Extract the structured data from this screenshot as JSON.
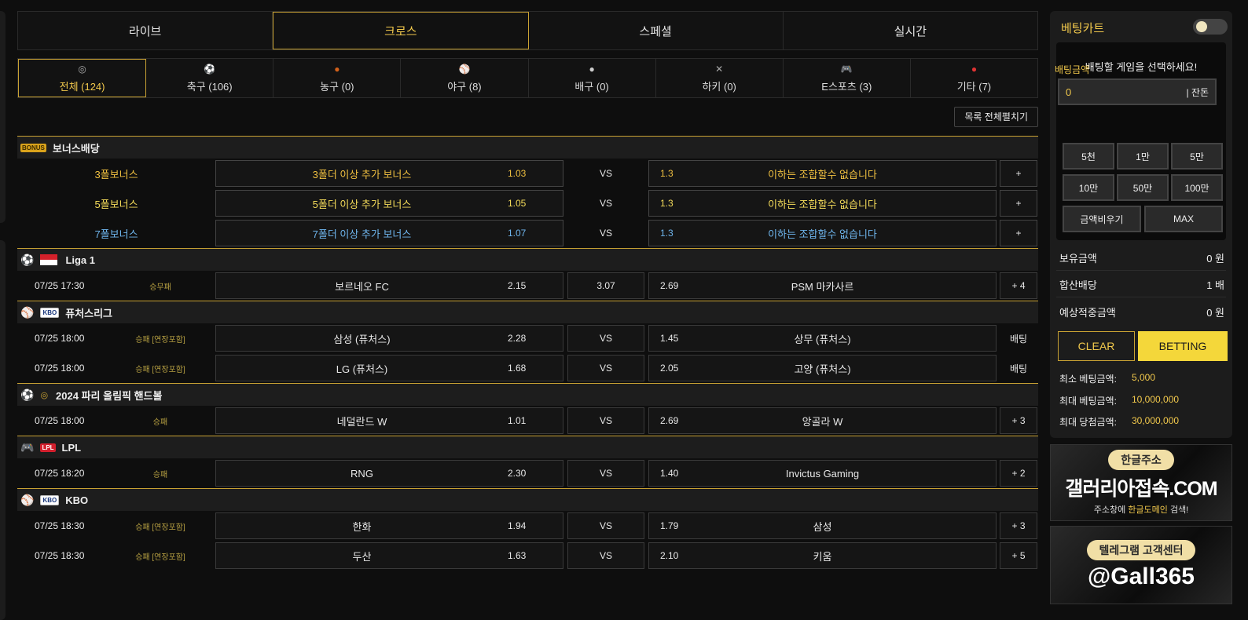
{
  "top_tabs": [
    {
      "label": "라이브"
    },
    {
      "label": "크로스"
    },
    {
      "label": "스페셜"
    },
    {
      "label": "실시간"
    }
  ],
  "sport_tabs": [
    {
      "label": "전체 (124)",
      "icon": "olympic-rings-icon"
    },
    {
      "label": "축구 (106)",
      "icon": "soccer-ball-icon"
    },
    {
      "label": "농구 (0)",
      "icon": "basketball-icon"
    },
    {
      "label": "야구 (8)",
      "icon": "baseball-icon"
    },
    {
      "label": "배구 (0)",
      "icon": "volleyball-icon"
    },
    {
      "label": "하키 (0)",
      "icon": "hockey-sticks-icon"
    },
    {
      "label": "E스포츠 (3)",
      "icon": "gamepad-icon"
    },
    {
      "label": "기타 (7)",
      "icon": "more-dots-icon"
    }
  ],
  "expand_all_label": "목록 전체펼치기",
  "bonus": {
    "title": "보너스배당",
    "logo_text": "BONUS",
    "rows": [
      {
        "name": "3폴보너스",
        "home": "3폴더 이상 추가 보너스",
        "home_odds": "1.03",
        "mid": "VS",
        "away_odds": "1.3",
        "away": "이하는 조합할수 없습니다",
        "more": "+"
      },
      {
        "name": "5폴보너스",
        "home": "5폴더 이상 추가 보너스",
        "home_odds": "1.05",
        "mid": "VS",
        "away_odds": "1.3",
        "away": "이하는 조합할수 없습니다",
        "more": "+"
      },
      {
        "name": "7폴보너스",
        "home": "7폴더 이상 추가 보너스",
        "home_odds": "1.07",
        "mid": "VS",
        "away_odds": "1.3",
        "away": "이하는 조합할수 없습니다",
        "more": "+"
      }
    ]
  },
  "leagues": [
    {
      "name": "Liga 1",
      "sport_icon": "soccer-ball-icon",
      "rows": [
        {
          "time": "07/25 17:30",
          "type": "승무패",
          "home": "보르네오 FC",
          "home_odds": "2.15",
          "mid": "3.07",
          "away_odds": "2.69",
          "away": "PSM 마카사르",
          "more": "+ 4"
        }
      ]
    },
    {
      "name": "퓨처스리그",
      "sport_icon": "baseball-icon",
      "logo_text": "KBO",
      "rows": [
        {
          "time": "07/25 18:00",
          "type": "승패 [연장포함]",
          "home": "삼성 (퓨처스)",
          "home_odds": "2.28",
          "mid": "VS",
          "away_odds": "1.45",
          "away": "상무 (퓨처스)",
          "more": "배팅"
        },
        {
          "time": "07/25 18:00",
          "type": "승패 [연장포함]",
          "home": "LG (퓨처스)",
          "home_odds": "1.68",
          "mid": "VS",
          "away_odds": "2.05",
          "away": "고양 (퓨처스)",
          "more": "배팅"
        }
      ]
    },
    {
      "name": "2024 파리 올림픽 핸드볼",
      "sport_icon": "handball-icon",
      "rows": [
        {
          "time": "07/25 18:00",
          "type": "승패",
          "home": "네덜란드 W",
          "home_odds": "1.01",
          "mid": "VS",
          "away_odds": "2.69",
          "away": "앙골라 W",
          "more": "+ 3"
        }
      ]
    },
    {
      "name": "LPL",
      "sport_icon": "gamepad-icon",
      "logo_text": "LPL",
      "rows": [
        {
          "time": "07/25 18:20",
          "type": "승패",
          "home": "RNG",
          "home_odds": "2.30",
          "mid": "VS",
          "away_odds": "1.40",
          "away": "Invictus Gaming",
          "more": "+ 2"
        }
      ]
    },
    {
      "name": "KBO",
      "sport_icon": "baseball-icon",
      "logo_text": "KBO",
      "rows": [
        {
          "time": "07/25 18:30",
          "type": "승패 [연장포함]",
          "home": "한화",
          "home_odds": "1.94",
          "mid": "VS",
          "away_odds": "1.79",
          "away": "삼성",
          "more": "+ 3"
        },
        {
          "time": "07/25 18:30",
          "type": "승패 [연장포함]",
          "home": "두산",
          "home_odds": "1.63",
          "mid": "VS",
          "away_odds": "2.10",
          "away": "키움",
          "more": "+ 5"
        }
      ]
    }
  ],
  "cart": {
    "title": "베팅카트",
    "message": "배팅할 게임을 선택하세요!",
    "amount_label": "배팅금액",
    "amount_value": "0",
    "balance_btn": "| 잔돈",
    "quick": [
      "5천",
      "1만",
      "5만",
      "10만",
      "50만",
      "100만"
    ],
    "clear_amount": "금액비우기",
    "max": "MAX",
    "stats": [
      {
        "label": "보유금액",
        "value": "0 원"
      },
      {
        "label": "합산배당",
        "value": "1 배"
      },
      {
        "label": "예상적중금액",
        "value": "0 원"
      }
    ],
    "clear_btn": "CLEAR",
    "bet_btn": "BETTING",
    "limits": [
      {
        "label": "최소 베팅금액:",
        "value": "5,000"
      },
      {
        "label": "최대 베팅금액:",
        "value": "10,000,000"
      },
      {
        "label": "최대 당첨금액:",
        "value": "30,000,000"
      }
    ]
  },
  "banner1": {
    "pill": "한글주소",
    "big": "갤러리아접속.COM",
    "small_pre": "주소창에 ",
    "small_hl": "한글도메인",
    "small_post": " 검색!"
  },
  "banner2": {
    "pill": "텔레그램 고객센터",
    "big": "@Gall365"
  }
}
